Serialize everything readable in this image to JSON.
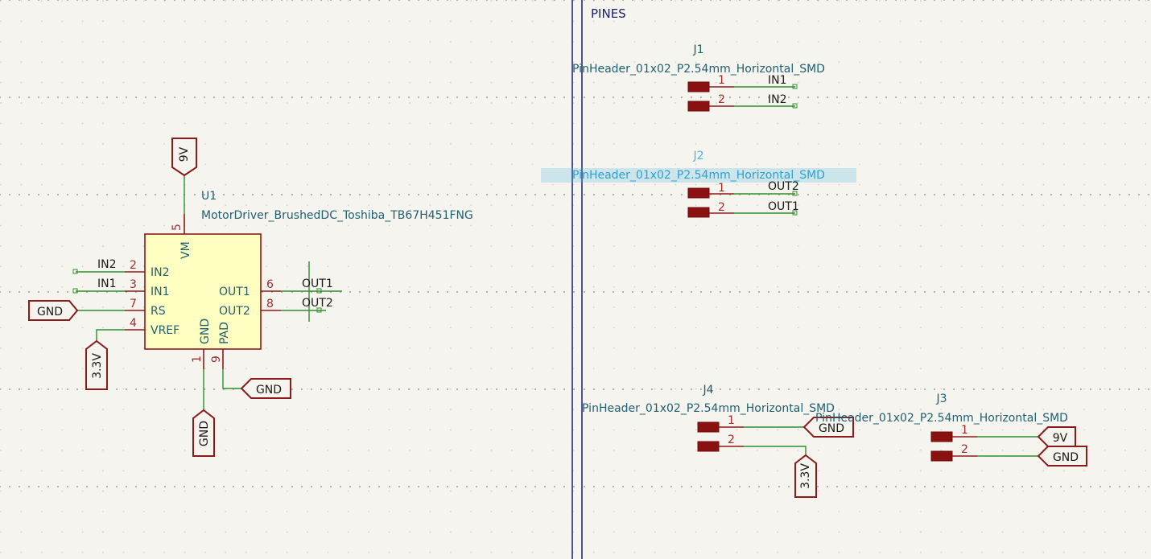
{
  "sheet": {
    "section_label": "PINES",
    "colors": {
      "background": "#f5f4ef",
      "wire": "#2e8f2e",
      "symbol": "#8b1a1a",
      "body_fill": "#ffffc2",
      "text": "#1f5f6f",
      "selection": "#4fb6e0",
      "separator": "#1c1c6e"
    }
  },
  "u1": {
    "ref": "U1",
    "value": "MotorDriver_BrushedDC_Toshiba_TB67H451FNG",
    "pins": {
      "vm": {
        "num": "5",
        "name": "VM"
      },
      "in2": {
        "num": "2",
        "name": "IN2"
      },
      "in1": {
        "num": "3",
        "name": "IN1"
      },
      "rs": {
        "num": "7",
        "name": "RS"
      },
      "vref": {
        "num": "4",
        "name": "VREF"
      },
      "gnd": {
        "num": "1",
        "name": "GND"
      },
      "pad": {
        "num": "9",
        "name": "PAD"
      },
      "out1": {
        "num": "6",
        "name": "OUT1"
      },
      "out2": {
        "num": "8",
        "name": "OUT2"
      }
    },
    "labels": {
      "in2": "IN2",
      "in1": "IN1",
      "out1": "OUT1",
      "out2": "OUT2"
    },
    "power": {
      "vm": "9V",
      "rs": "GND",
      "vref": "3.3V",
      "gnd": "GND",
      "pad": "GND"
    }
  },
  "j1": {
    "ref": "J1",
    "value": "PinHeader_01x02_P2.54mm_Horizontal_SMD",
    "pin1": "1",
    "pin2": "2",
    "net1": "IN1",
    "net2": "IN2"
  },
  "j2": {
    "ref": "J2",
    "value": "PinHeader_01x02_P2.54mm_Horizontal_SMD",
    "pin1": "1",
    "pin2": "2",
    "net1": "OUT2",
    "net2": "OUT1"
  },
  "j4": {
    "ref": "J4",
    "value": "PinHeader_01x02_P2.54mm_Horizontal_SMD",
    "pin1": "1",
    "pin2": "2",
    "net1": "GND",
    "net2": "3.3V"
  },
  "j3": {
    "ref": "J3",
    "value": "PinHeader_01x02_P2.54mm_Horizontal_SMD",
    "pin1": "1",
    "pin2": "2",
    "net1": "9V",
    "net2": "GND"
  }
}
